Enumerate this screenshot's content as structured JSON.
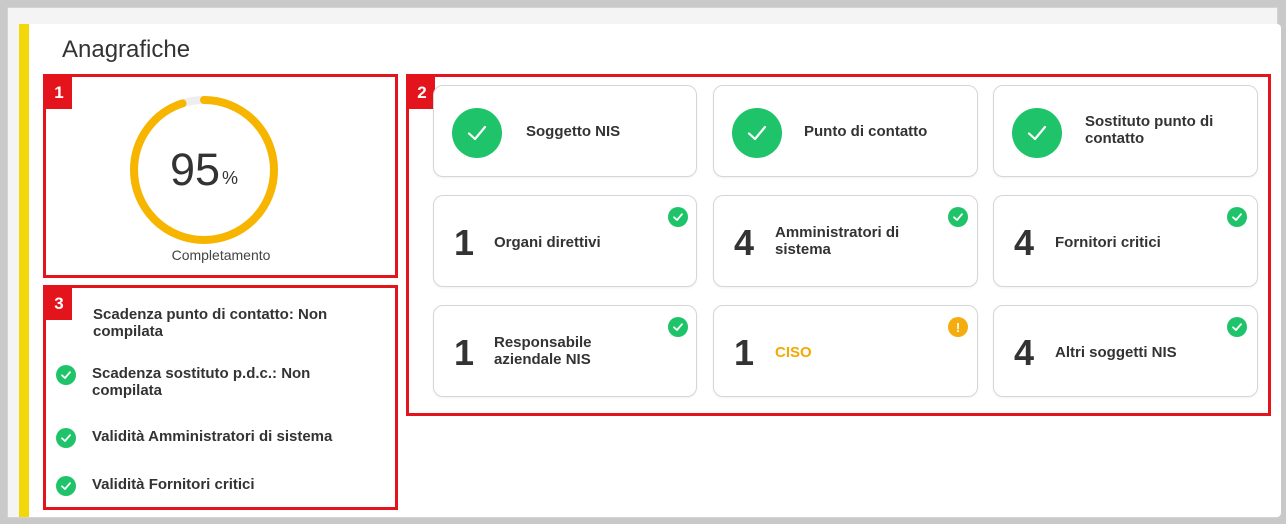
{
  "section_title": "Anagrafiche",
  "annotations": [
    "1",
    "2",
    "3"
  ],
  "completion": {
    "value": 95,
    "unit": "%",
    "label": "Completamento",
    "color": "#f7b500"
  },
  "tiles": [
    {
      "label": "Soggetto NIS",
      "status": "check-icon"
    },
    {
      "label": "Punto di contatto",
      "status": "check-icon"
    },
    {
      "label": "Sostituto punto di contatto",
      "status": "check-icon"
    },
    {
      "count": "1",
      "label": "Organi direttivi",
      "status": "ok"
    },
    {
      "count": "4",
      "label": "Amministratori di sistema",
      "status": "ok"
    },
    {
      "count": "4",
      "label": "Fornitori critici",
      "status": "ok"
    },
    {
      "count": "1",
      "label": "Responsabile aziendale NIS",
      "status": "ok"
    },
    {
      "count": "1",
      "label": "CISO",
      "status": "warning",
      "label_color": "#f5a800",
      "warn_glyph": "!"
    },
    {
      "count": "4",
      "label": "Altri soggetti NIS",
      "status": "ok"
    }
  ],
  "checklist": [
    {
      "text": "Scadenza punto di contatto: Non compilata",
      "status": "none"
    },
    {
      "text": "Scadenza sostituto p.d.c.: Non compilata",
      "status": "ok"
    },
    {
      "text": "Validità Amministratori di sistema",
      "status": "ok"
    },
    {
      "text": "Validità Fornitori critici",
      "status": "ok"
    }
  ],
  "colors": {
    "accent": "#f2d808",
    "ok": "#1fc46a",
    "warning": "#f5ac0e",
    "annotation": "#e3141c"
  }
}
